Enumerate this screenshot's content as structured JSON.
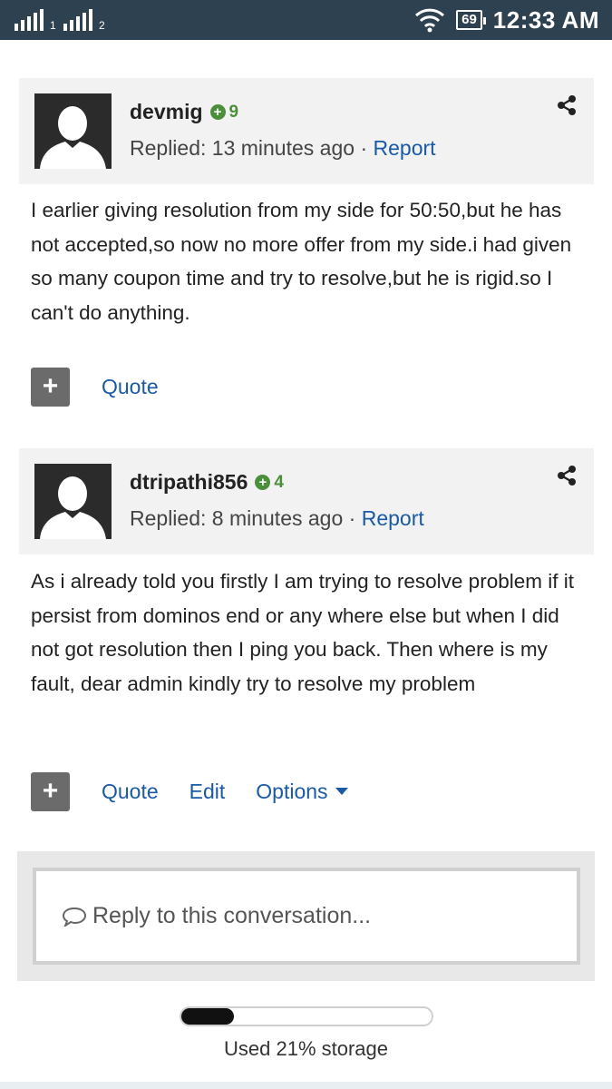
{
  "status_bar": {
    "sim1": "1",
    "sim2": "2",
    "battery": "69",
    "time": "12:33 AM"
  },
  "posts": [
    {
      "username": "devmig",
      "badge_count": "9",
      "replied_label": "Replied: 13 minutes ago",
      "separator": "·",
      "report_label": "Report",
      "body": "I earlier giving resolution from my side for 50:50,but he has not accepted,so now no more offer from my side.i had given so many coupon time and try to resolve,but he is rigid.so I can't do anything.",
      "actions": {
        "quote": "Quote"
      }
    },
    {
      "username": "dtripathi856",
      "badge_count": "4",
      "replied_label": "Replied: 8 minutes ago",
      "separator": "·",
      "report_label": "Report",
      "body": "As i already told you firstly I am trying to resolve problem if it persist from dominos end or any where else but when I did not got resolution then I ping you back. Then where is my fault, dear admin kindly try to resolve my problem",
      "actions": {
        "quote": "Quote",
        "edit": "Edit",
        "options": "Options"
      }
    }
  ],
  "reply_box": {
    "placeholder": "Reply to this conversation..."
  },
  "storage": {
    "label": "Used 21% storage",
    "used_fraction": 0.21
  },
  "icons": {
    "share": "share-icon",
    "plus": "plus-icon",
    "reply": "speech-bubble-icon",
    "wifi": "wifi-icon",
    "battery": "battery-icon",
    "signal": "signal-icon",
    "caret": "chevron-down-icon"
  },
  "colors": {
    "link": "#1a5aa5",
    "badge": "#4c8f3a",
    "status_bar": "#2d4150",
    "post_header_bg": "#f2f2f2",
    "plus_button": "#6b6b6b"
  }
}
